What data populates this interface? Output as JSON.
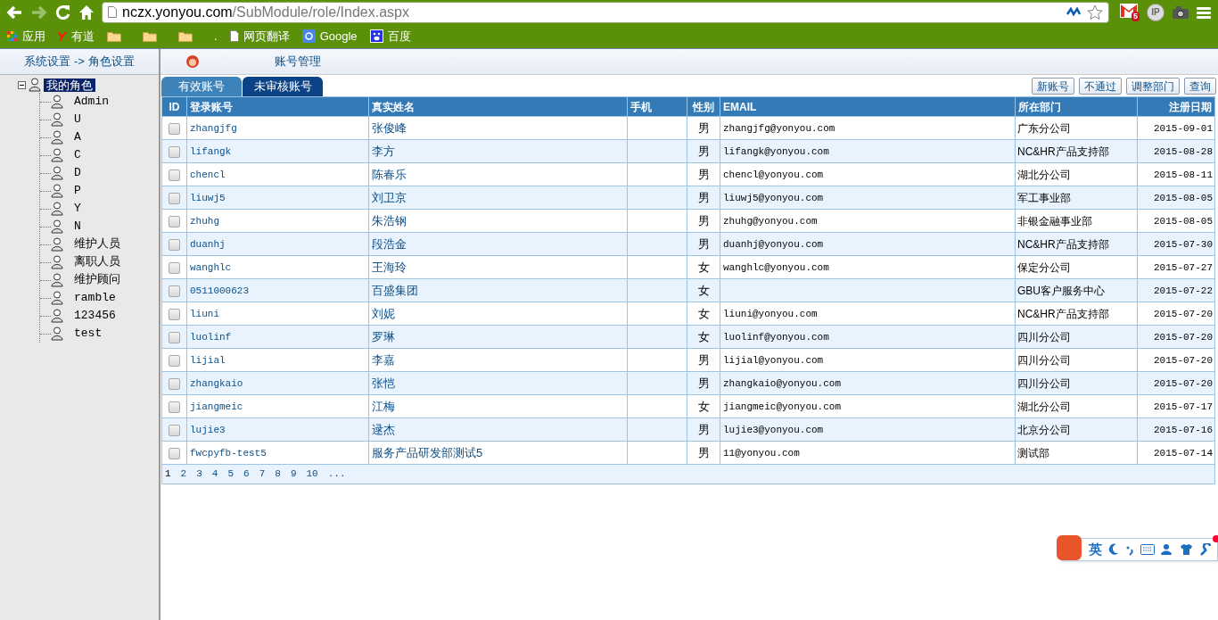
{
  "browser": {
    "url_host": "nczx.yonyou.com",
    "url_path": "/SubModule/role/Index.aspx",
    "back_enabled": true,
    "forward_enabled": false,
    "extensions": [
      {
        "kind": "mail",
        "badge": "5"
      },
      {
        "kind": "ip",
        "label": "IP"
      },
      {
        "kind": "camera"
      }
    ],
    "bookmarks": [
      {
        "kind": "apps",
        "label": "应用"
      },
      {
        "kind": "youdao",
        "label": "有道"
      },
      {
        "kind": "folder"
      },
      {
        "kind": "folder"
      },
      {
        "kind": "folder"
      },
      {
        "kind": "text",
        "label": "."
      },
      {
        "kind": "page",
        "label": "网页翻译"
      },
      {
        "kind": "google",
        "label": "Google"
      },
      {
        "kind": "baidu",
        "label": "百度"
      }
    ]
  },
  "sidebar": {
    "breadcrumb": "系统设置 -> 角色设置",
    "tree": {
      "label": "我的角色",
      "selected": true,
      "expanded": true,
      "children": [
        {
          "label": "Admin",
          "selected": false
        },
        {
          "label": "U",
          "selected": false
        },
        {
          "label": "A",
          "selected": false
        },
        {
          "label": "C",
          "selected": false
        },
        {
          "label": "D",
          "selected": false
        },
        {
          "label": "P",
          "selected": false
        },
        {
          "label": "Y",
          "selected": false
        },
        {
          "label": "N",
          "selected": false
        },
        {
          "label": "维护人员",
          "selected": false
        },
        {
          "label": "离职人员",
          "selected": false
        },
        {
          "label": "维护顾问",
          "selected": false
        },
        {
          "label": "ramble",
          "selected": false
        },
        {
          "label": "123456",
          "selected": false
        },
        {
          "label": "test",
          "selected": false
        }
      ]
    }
  },
  "header": {
    "title": "账号管理"
  },
  "tabs": [
    {
      "label": "有效账号",
      "selected": false
    },
    {
      "label": "未审核账号",
      "selected": true
    }
  ],
  "buttons": [
    "新账号",
    "不通过",
    "调整部门",
    "查询"
  ],
  "table": {
    "columns": [
      "ID",
      "登录账号",
      "真实姓名",
      "手机",
      "性别",
      "EMAIL",
      "所在部门",
      "注册日期"
    ],
    "rows": [
      {
        "checked": false,
        "login": "zhangjfg",
        "name": "张俊峰",
        "phone": "",
        "sex": "男",
        "email": "zhangjfg@yonyou.com",
        "dept": "广东分公司",
        "date": "2015-09-01"
      },
      {
        "checked": false,
        "login": "lifangk",
        "name": "李方",
        "phone": "",
        "sex": "男",
        "email": "lifangk@yonyou.com",
        "dept": "NC&HR产品支持部",
        "date": "2015-08-28"
      },
      {
        "checked": false,
        "login": "chencl",
        "name": "陈春乐",
        "phone": "",
        "sex": "男",
        "email": "chencl@yonyou.com",
        "dept": "湖北分公司",
        "date": "2015-08-11"
      },
      {
        "checked": false,
        "login": "liuwj5",
        "name": "刘卫京",
        "phone": "",
        "sex": "男",
        "email": "liuwj5@yonyou.com",
        "dept": "军工事业部",
        "date": "2015-08-05"
      },
      {
        "checked": false,
        "login": "zhuhg",
        "name": "朱浩钢",
        "phone": "",
        "sex": "男",
        "email": "zhuhg@yonyou.com",
        "dept": "非银金融事业部",
        "date": "2015-08-05"
      },
      {
        "checked": false,
        "login": "duanhj",
        "name": "段浩金",
        "phone": "",
        "sex": "男",
        "email": "duanhj@yonyou.com",
        "dept": "NC&HR产品支持部",
        "date": "2015-07-30"
      },
      {
        "checked": false,
        "login": "wanghlc",
        "name": "王海玲",
        "phone": "",
        "sex": "女",
        "email": "wanghlc@yonyou.com",
        "dept": "保定分公司",
        "date": "2015-07-27"
      },
      {
        "checked": false,
        "login": "0511000623",
        "name": "百盛集团",
        "phone": "",
        "sex": "女",
        "email": "",
        "dept": "GBU客户服务中心",
        "date": "2015-07-22"
      },
      {
        "checked": false,
        "login": "liuni",
        "name": "刘妮",
        "phone": "",
        "sex": "女",
        "email": "liuni@yonyou.com",
        "dept": "NC&HR产品支持部",
        "date": "2015-07-20"
      },
      {
        "checked": false,
        "login": "luolinf",
        "name": "罗琳",
        "phone": "",
        "sex": "女",
        "email": "luolinf@yonyou.com",
        "dept": "四川分公司",
        "date": "2015-07-20"
      },
      {
        "checked": false,
        "login": "lijial",
        "name": "李嘉",
        "phone": "",
        "sex": "男",
        "email": "lijial@yonyou.com",
        "dept": "四川分公司",
        "date": "2015-07-20"
      },
      {
        "checked": false,
        "login": "zhangkaio",
        "name": "张恺",
        "phone": "",
        "sex": "男",
        "email": "zhangkaio@yonyou.com",
        "dept": "四川分公司",
        "date": "2015-07-20"
      },
      {
        "checked": false,
        "login": "jiangmeic",
        "name": "江梅",
        "phone": "",
        "sex": "女",
        "email": "jiangmeic@yonyou.com",
        "dept": "湖北分公司",
        "date": "2015-07-17"
      },
      {
        "checked": false,
        "login": "lujie3",
        "name": "逯杰",
        "phone": "",
        "sex": "男",
        "email": "lujie3@yonyou.com",
        "dept": "北京分公司",
        "date": "2015-07-16"
      },
      {
        "checked": false,
        "login": "fwcpyfb-test5",
        "name": "服务产品研发部测试5",
        "phone": "",
        "sex": "男",
        "email": "11@yonyou.com",
        "dept": "测试部",
        "date": "2015-07-14"
      }
    ],
    "pages": [
      {
        "label": "1",
        "selected": true
      },
      {
        "label": "2",
        "selected": false
      },
      {
        "label": "3",
        "selected": false
      },
      {
        "label": "4",
        "selected": false
      },
      {
        "label": "5",
        "selected": false
      },
      {
        "label": "6",
        "selected": false
      },
      {
        "label": "7",
        "selected": false
      },
      {
        "label": "8",
        "selected": false
      },
      {
        "label": "9",
        "selected": false
      },
      {
        "label": "10",
        "selected": false
      },
      {
        "label": "...",
        "selected": false
      }
    ]
  },
  "ime_toolbar": {
    "mode": "英"
  }
}
